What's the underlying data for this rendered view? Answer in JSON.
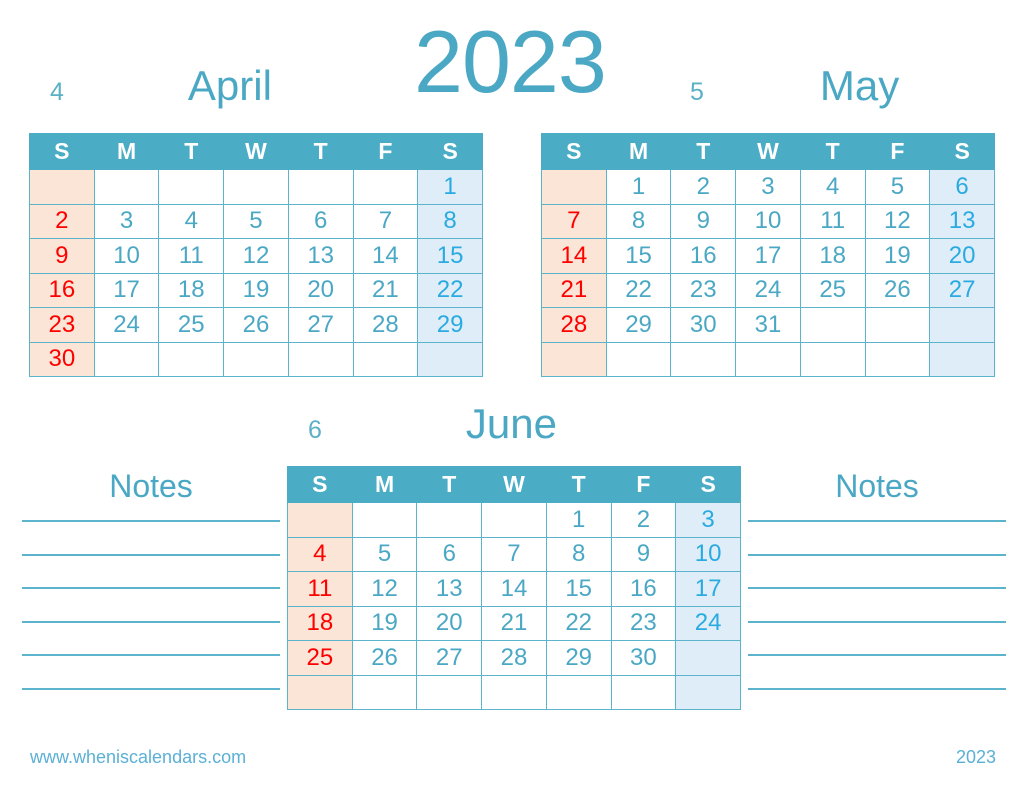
{
  "year_title": "2023",
  "footer": {
    "url": "www.wheniscalendars.com",
    "year": "2023"
  },
  "weekday_headers": [
    "S",
    "M",
    "T",
    "W",
    "T",
    "F",
    "S"
  ],
  "notes": {
    "left_title": "Notes",
    "right_title": "Notes",
    "line_count": 6
  },
  "colors": {
    "header_bg": "#4BACC6",
    "accent_text": "#4BA8C4",
    "sunday_bg": "#FBE5D6",
    "sunday_text": "#FF0000",
    "saturday_bg": "#DEEDF7",
    "saturday_text": "#29ABE2",
    "grid_line": "#5BB3CC",
    "footer_text": "#5BB0D6",
    "page_bg": "#FFFFFF"
  },
  "months": {
    "april": {
      "number": "4",
      "name": "April",
      "weeks": [
        [
          "",
          "",
          "",
          "",
          "",
          "",
          "1"
        ],
        [
          "2",
          "3",
          "4",
          "5",
          "6",
          "7",
          "8"
        ],
        [
          "9",
          "10",
          "11",
          "12",
          "13",
          "14",
          "15"
        ],
        [
          "16",
          "17",
          "18",
          "19",
          "20",
          "21",
          "22"
        ],
        [
          "23",
          "24",
          "25",
          "26",
          "27",
          "28",
          "29"
        ],
        [
          "30",
          "",
          "",
          "",
          "",
          "",
          ""
        ]
      ]
    },
    "may": {
      "number": "5",
      "name": "May",
      "weeks": [
        [
          "",
          "1",
          "2",
          "3",
          "4",
          "5",
          "6"
        ],
        [
          "7",
          "8",
          "9",
          "10",
          "11",
          "12",
          "13"
        ],
        [
          "14",
          "15",
          "16",
          "17",
          "18",
          "19",
          "20"
        ],
        [
          "21",
          "22",
          "23",
          "24",
          "25",
          "26",
          "27"
        ],
        [
          "28",
          "29",
          "30",
          "31",
          "",
          "",
          ""
        ],
        [
          "",
          "",
          "",
          "",
          "",
          "",
          ""
        ]
      ]
    },
    "june": {
      "number": "6",
      "name": "June",
      "weeks": [
        [
          "",
          "",
          "",
          "",
          "1",
          "2",
          "3"
        ],
        [
          "4",
          "5",
          "6",
          "7",
          "8",
          "9",
          "10"
        ],
        [
          "11",
          "12",
          "13",
          "14",
          "15",
          "16",
          "17"
        ],
        [
          "18",
          "19",
          "20",
          "21",
          "22",
          "23",
          "24"
        ],
        [
          "25",
          "26",
          "27",
          "28",
          "29",
          "30",
          ""
        ],
        [
          "",
          "",
          "",
          "",
          "",
          "",
          ""
        ]
      ]
    }
  }
}
